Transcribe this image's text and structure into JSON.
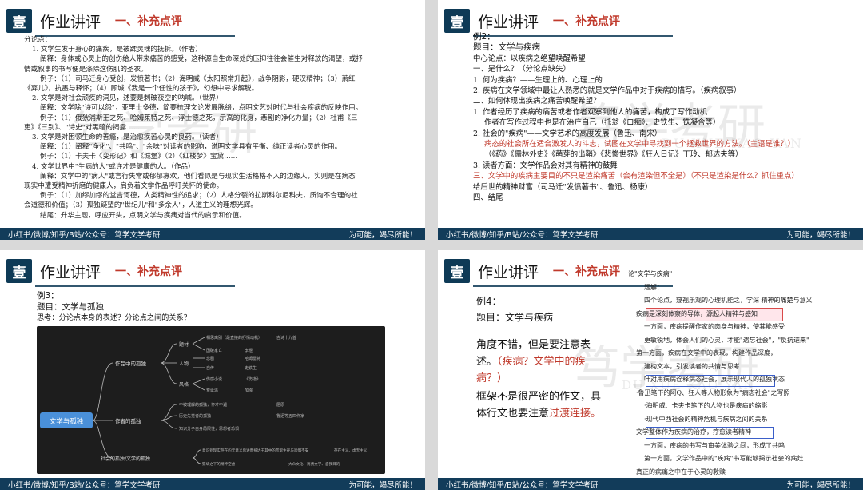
{
  "common": {
    "badge": "壹",
    "title": "作业讲评",
    "subtitle": "一、补充点评",
    "footer_left": "小红书/微博/知乎/B站/公众号：笃学文学考研",
    "footer_right": "为可能，竭尽所能！",
    "watermark_cn": "笃学考研",
    "watermark_en": "DU XUE KAO YAN"
  },
  "slide1": {
    "lines": [
      {
        "text": "分论点：",
        "color": "#222",
        "indent": 0
      },
      {
        "text": "1. 文学生发于身心的痛疾，是被蹂灵魂的抚拆。（作者）",
        "color": "#222",
        "indent": 1
      },
      {
        "text": "阐释：身体或心灵上的创伤给人带来痛苦的感受，这种源自生命深处的压抑往往会催生对释放的渴望，或抒",
        "color": "#222",
        "indent": 2
      },
      {
        "text": "情或叙事的书写便是涤除这伤肌的圣衣。",
        "color": "#222",
        "indent": 0
      },
      {
        "text": "例子：（1）司马迁身心受创，发愤著书；（2）海明威《太阳照常升起》，战争阴影，硬汉精神；（3）萧红",
        "color": "#222",
        "indent": 2
      },
      {
        "text": "《弃儿》，抗墨与释怀；（4）顾城《我是一个任性的孩子》，幻想中寻求解脱。",
        "color": "#222",
        "indent": 0
      },
      {
        "text": "2. 文学是对社会顽疾的洞见，述要是刺破夜空的呐喊。（世界）",
        "color": "#222",
        "indent": 1
      },
      {
        "text": "阐释：文学除\"诗可以怨\"，亚里士多德，简要梳理文论发展脉络，点明文艺对时代与社会疾病的反映作用。",
        "color": "#222",
        "indent": 2
      },
      {
        "text": "例子：（1）俄狄浦斯王之死、哈姆莱特之死、浮士德之死，示高的化身，悲剧的净化力量；（2）杜甫《三",
        "color": "#222",
        "indent": 2
      },
      {
        "text": "吏》《三别》、\"诗史\"对黑暗的揭露……",
        "color": "#222",
        "indent": 0
      },
      {
        "text": "3. 文学是对困顿生命的善瘾，是治愈疾苦心灵的良药。（读者）",
        "color": "#222",
        "indent": 1
      },
      {
        "text": "阐释：（1）阐释\"净化\"、\"共鸣\"、\"余味\"对读者的影响，说明文学具有平衡、纯正读者心灵的作用。",
        "color": "#222",
        "indent": 2
      },
      {
        "text": "例子：（1）卡夫卡《变形记》和《城堡》（2）《红楼梦》宝黛……",
        "color": "#222",
        "indent": 2
      },
      {
        "text": "4. 文学世界中\"生病的人\"或许才是健康的人。（作品）",
        "color": "#222",
        "indent": 1
      },
      {
        "text": "阐释：文学中的\"病人\"或言行失常或郁郁寡欢，他们看似是与现实生活格格不入的边缘人，实则是在病态",
        "color": "#222",
        "indent": 2
      },
      {
        "text": "现实中遭受精神折磨的健康人，肩负着文学作品呼吁关怀的使命。",
        "color": "#222",
        "indent": 0
      },
      {
        "text": "例子：（1）加缪加缪的堂吉诃德，人类精神性的追求；（2）人格分裂的拉斯科尔尼科夫，质询不合理的社",
        "color": "#222",
        "indent": 2
      },
      {
        "text": "会道德和价值；（3）孤独疑望的\"世纪儿\"和\"多余人\"，人道主义的理想光辉。",
        "color": "#222",
        "indent": 0
      },
      {
        "text": "结尾：升华主题，呼应开头，点明文学与疾病对当代的启示和价值。",
        "color": "#222",
        "indent": 2
      }
    ]
  },
  "slide2": {
    "lines": [
      {
        "text": "例2：",
        "style": "h"
      },
      {
        "text": "题目：文学与疾病",
        "style": "h"
      },
      {
        "text": "中心论点：以疾病之绝望唤醒希望",
        "style": "n"
      },
      {
        "text": "一、是什么？（分论点缺失）",
        "style": "n",
        "red_tail": "（分论点缺失）"
      },
      {
        "text": "1. 何为疾病？——生理上的、心理上的",
        "style": "n"
      },
      {
        "text": "2. 疾病在文学领域中最让人熟悉的就是文学作品中对于疾病的描写。（疾病叙事）",
        "style": "n"
      },
      {
        "text": "二、如何体现出疾病之痛苦唤醒希望？",
        "style": "n"
      },
      {
        "text": "1. 作者经历了疾病的痛苦或者作者观察到他人的痛苦，构成了写作动机",
        "style": "n"
      },
      {
        "text": "作者在写作过程中也是在治疗自己（托翁《白痴》、史铁生、铁凝含等）",
        "style": "i"
      },
      {
        "text": "2. 社会的\"疾病\"——文学艺术的高度发展（鲁迅、南宋）",
        "style": "n"
      },
      {
        "text": "病态的社会所在适合激发人的斗志，试图在文学中寻找到一个拯救世界的方法。（主语是谁？）",
        "style": "r"
      },
      {
        "text": "（《药》《儒林外史》《萌芽的出鞘》《悲惨世界》《狂人日记》丁玲、郁达夫等）",
        "style": "i"
      },
      {
        "text": "3. 读者方面：文学作品会对其有精神的鼓舞",
        "style": "n"
      },
      {
        "text": "三、文学中的疾病主要目的不只是渲染痛苦（会有渲染但不全是）（不只是渲染是什么？抓住重点）",
        "style": "m"
      },
      {
        "text": "给后世的精神财富（司马迁\"发愤著书\"、鲁迅、杨康）",
        "style": "n"
      },
      {
        "text": "四、结尾",
        "style": "n"
      }
    ]
  },
  "slide3": {
    "example": "例3：",
    "topic": "题目：文学与孤独",
    "question": "思考：分论点本身的表述？分论点之间的关系？",
    "mindmap": {
      "root": "文学与孤独",
      "branches": [
        {
          "label": "作品中的孤独",
          "children": [
            {
              "label": "题材",
              "leaves": [
                "相思离别（最直接的抒情动机）",
                "国破家亡",
                "悲剧",
                "自传"
              ],
              "tags": [
                "古诗十九首",
                "李煜",
                "哈姆雷特",
                "史铁生"
              ]
            },
            {
              "label": "人物",
              "leaves": [],
              "tags": []
            },
            {
              "label": "风格",
              "leaves": [
                "伤感小说",
                "荒诞派"
              ],
              "tags": [
                "《伤逝》",
                "加缪"
              ]
            }
          ]
        },
        {
          "label": "作者的孤独",
          "children": [
            {
              "label": "",
              "leaves": [
                "不被理解的孤独，怀才不遇",
                "历史先觉者的孤独",
                "知识分子自身局限性，思想者恐惧"
              ],
              "tags": [
                "屈原",
                "鲁迅等五四作家",
                ""
              ]
            }
          ]
        },
        {
          "label": "社会的孤独/文学的孤独",
          "children": [
            {
              "label": "",
              "leaves": [
                "意识到现实存在的无意义后进而抵达于其中的荒诞生存与恐惧不安",
                "繁华之下的精神空虚"
              ],
              "tags": [
                "存在主义、虚无主义",
                "大众文化、消费文学、自我目的"
              ]
            }
          ]
        }
      ]
    }
  },
  "slide4": {
    "example": "例4：",
    "topic": "题目：文学与疾病",
    "comment_a": "角度不错，但是要注意表述。",
    "comment_red": "（疾病？文学中的疾病？）",
    "comment_b": "框架不是很严密的作文，具体行文也要注意",
    "comment_red2": "过渡连接。",
    "notes": [
      "论\"文学与疾病\"",
      "题解：",
      "四个论点，窥视乐观的心理机能之，学深 精神的痛楚与意义",
      "疾病是深刻体察的导体，源起人精神与感知",
      "一方面，疾病提醒作家的肉身与精神，使其能感受",
      "更敏锐地，体会人们的心灵，才能\"遗忘社会\"，\"反抗逆来\"",
      "第一方面，疾病在文学中的表现，构建作品深度，",
      "建构文本，引发读者的共情与思考",
      "叶对用疾病诠释病态社会，展示现代人的孤独状态",
      "·鲁迅笔下的阿Q、狂人等人物形象为\"病态社会\"之写照",
      "·海明威、卡夫卡笔下的人物也是疾病的缩影",
      "·现代中西社会的精神危机与疾病之间的关系",
      "文学整体作为疾病的治疗，疗愈读者精神",
      "一方面，疾病的书写与审美体验之间，形成了共鸣",
      "第一方面，文学作品中的\"疾病\"书写能够揭示社会的病灶",
      "真正的病痛之中在于心灵的救赎"
    ]
  }
}
